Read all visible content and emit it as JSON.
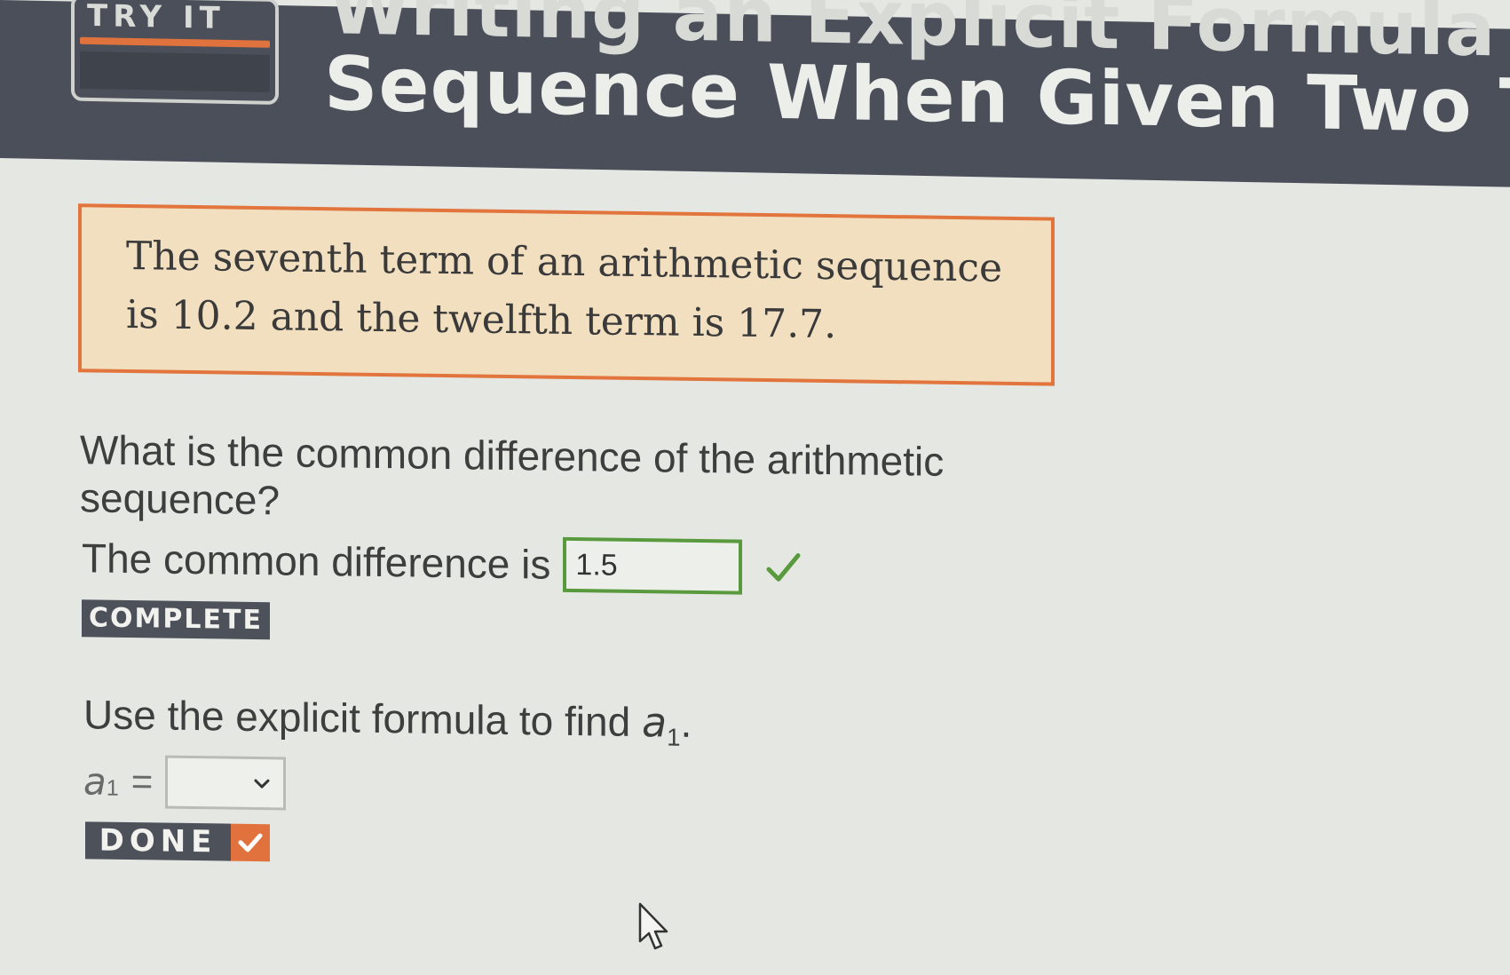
{
  "header": {
    "badge_label": "TRY IT",
    "title_line1": "Writing an Explicit Formula for a",
    "title_line2": "Sequence When Given Two Terms"
  },
  "problem": {
    "text": "The seventh term of an arithmetic sequence is 10.2 and the twelfth term is 17.7."
  },
  "part1": {
    "question": "What is the common difference of the arithmetic sequence?",
    "answer_label": "The common difference is",
    "answer_value": "1.5",
    "status": "COMPLETE"
  },
  "part2": {
    "instruction": "Use the explicit formula to find",
    "variable": "a",
    "subscript": "1",
    "punctuation": ".",
    "selected_value": ""
  },
  "done_button": {
    "label": "DONE"
  },
  "colors": {
    "header_bg": "#4a4f5a",
    "accent_orange": "#e2723d",
    "correct_green": "#5a9a3e",
    "problem_bg": "#f2dfbf"
  },
  "icons": {
    "answer_check": "checkmark-icon",
    "dropdown": "chevron-down-icon",
    "done_check": "checkmark-icon",
    "cursor": "mouse-pointer-icon"
  }
}
